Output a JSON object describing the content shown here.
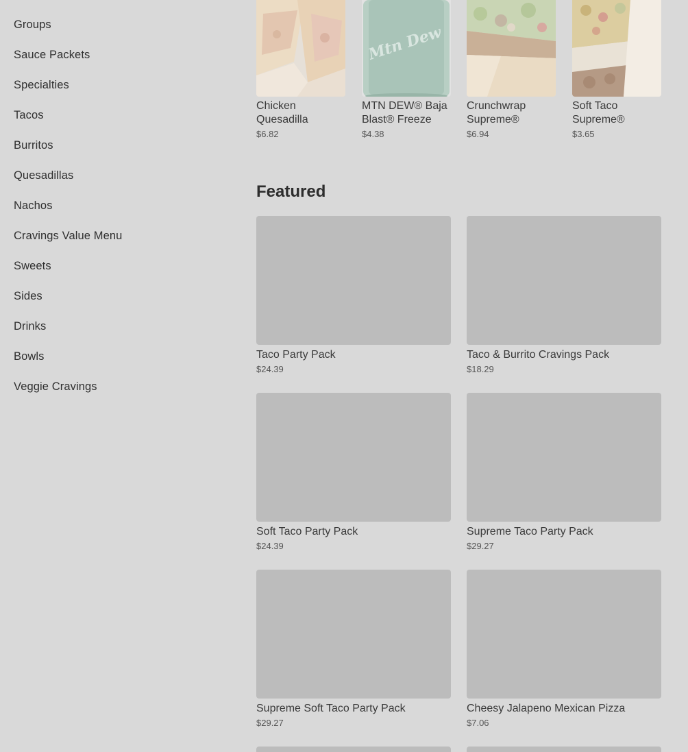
{
  "sidebar": {
    "items": [
      {
        "label": "Groups"
      },
      {
        "label": "Sauce Packets"
      },
      {
        "label": "Specialties"
      },
      {
        "label": "Tacos"
      },
      {
        "label": "Burritos"
      },
      {
        "label": "Quesadillas"
      },
      {
        "label": "Nachos"
      },
      {
        "label": "Cravings Value Menu"
      },
      {
        "label": "Sweets"
      },
      {
        "label": "Sides"
      },
      {
        "label": "Drinks"
      },
      {
        "label": "Bowls"
      },
      {
        "label": "Veggie Cravings"
      }
    ]
  },
  "popular": {
    "items": [
      {
        "name": "Chicken Quesadilla",
        "price": "$6.82",
        "icon": "quesadilla-image"
      },
      {
        "name": "MTN DEW® Baja Blast® Freeze",
        "price": "$4.38",
        "icon": "freeze-drink-image",
        "cup_text": "Mtn Dew"
      },
      {
        "name": "Crunchwrap Supreme®",
        "price": "$6.94",
        "icon": "crunchwrap-image"
      },
      {
        "name": "Soft Taco Supreme®",
        "price": "$3.65",
        "icon": "soft-taco-image"
      }
    ]
  },
  "featured": {
    "title": "Featured",
    "items": [
      {
        "name": "Taco Party Pack",
        "price": "$24.39"
      },
      {
        "name": "Taco & Burrito Cravings Pack",
        "price": "$18.29"
      },
      {
        "name": "Soft Taco Party Pack",
        "price": "$24.39"
      },
      {
        "name": "Supreme Taco Party Pack",
        "price": "$29.27"
      },
      {
        "name": "Supreme Soft Taco Party Pack",
        "price": "$29.27"
      },
      {
        "name": "Cheesy Jalapeno Mexican Pizza",
        "price": "$7.06"
      }
    ]
  },
  "colors": {
    "overlay_background": "#d9d9d9",
    "placeholder": "#bcbcbc",
    "text": "#3a3a3a"
  }
}
